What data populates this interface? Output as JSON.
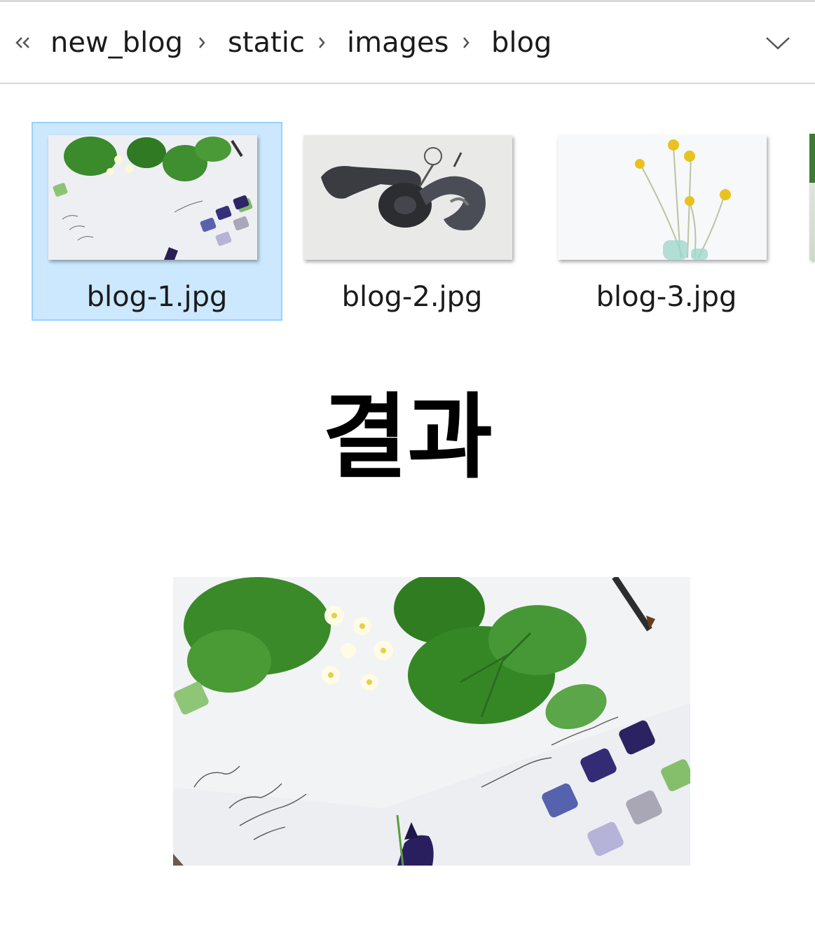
{
  "breadcrumb": {
    "back_icon": "double-chevron-left-icon",
    "items": [
      "new_blog",
      "static",
      "images",
      "blog"
    ],
    "separator_icon": "chevron-right-icon",
    "dropdown_icon": "chevron-down-icon"
  },
  "files": [
    {
      "name": "blog-1.jpg",
      "selected": true
    },
    {
      "name": "blog-2.jpg",
      "selected": false
    },
    {
      "name": "blog-3.jpg",
      "selected": false
    }
  ],
  "result": {
    "heading": "결과"
  },
  "colors": {
    "selection_bg": "#cce8ff",
    "selection_border": "#99d1ff"
  }
}
